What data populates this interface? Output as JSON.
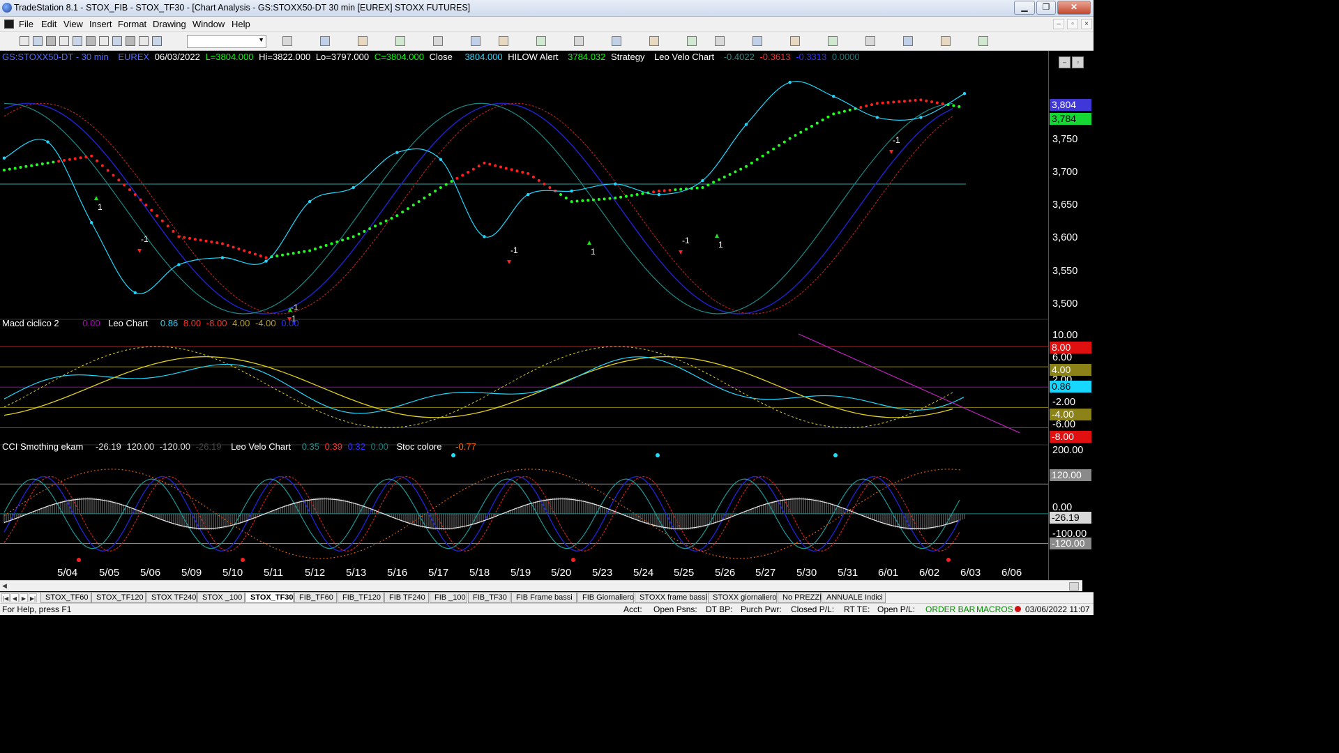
{
  "window": {
    "title": "TradeStation 8.1 - STOX_FIB - STOX_TF30 - [Chart Analysis - GS:STOXX50-DT  30 min  [EUREX] STOXX FUTURES]",
    "minimize": "▁",
    "restore": "❐",
    "close": "✕"
  },
  "menu": [
    "File",
    "Edit",
    "View",
    "Insert",
    "Format",
    "Drawing",
    "Window",
    "Help"
  ],
  "price_header": {
    "symbol": "GS:STOXX50-DT - 30 min",
    "exchange": "EUREX",
    "date": "06/03/2022",
    "last": "L=3804.000",
    "high": "Hi=3822.000",
    "low": "Lo=3797.000",
    "close_eq": "C=3804.000",
    "close_label": "Close",
    "close_val": "3804.000",
    "hilow_label": "HILOW Alert",
    "hilow_val": "3784.032",
    "strategy_label": "Strategy",
    "leo_label": "Leo Velo Chart",
    "leo_v1": "-0.4022",
    "leo_v2": "-0.3613",
    "leo_v3": "-0.3313",
    "leo_v4": "0.0000"
  },
  "macd_header": {
    "name": "Macd ciclico 2",
    "v0": "0.00",
    "leo_label": "Leo Chart",
    "v1": "0.86",
    "v2": "8.00",
    "v3": "-8.00",
    "v4": "4.00",
    "v5": "-4.00",
    "v6": "0.00"
  },
  "cci_header": {
    "name": "CCI Smothing ekam",
    "v1": "-26.19",
    "v2": "120.00",
    "v3": "-120.00",
    "v4": "-26.19",
    "leo_label": "Leo Velo Chart",
    "l1": "0.35",
    "l2": "0.39",
    "l3": "0.32",
    "l4": "0.00",
    "stoc_label": "Stoc colore",
    "stoc_val": "-0.77"
  },
  "price_axis": [
    "3,750",
    "3,700",
    "3,650",
    "3,600",
    "3,550",
    "3,500"
  ],
  "price_tags": {
    "last": "3,804",
    "hilow": "3,784"
  },
  "macd_axis": [
    "10.00",
    "6.00",
    "2.00",
    "-2.00",
    "-6.00"
  ],
  "macd_tags": {
    "t8": "8.00",
    "t4": "4.00",
    "cur": "0.86",
    "tm4": "-4.00",
    "tm8": "-8.00"
  },
  "cci_axis": [
    "200.00",
    "0.00",
    "-100.00"
  ],
  "cci_tags": {
    "t120": "120.00",
    "cur": "-26.19",
    "tm120": "-120.00"
  },
  "signal_labels": [
    "1",
    "-1",
    "-1",
    "1",
    "-1",
    "-1",
    "1",
    "1",
    "-1"
  ],
  "dates": [
    "5/04",
    "5/05",
    "5/06",
    "5/09",
    "5/10",
    "5/11",
    "5/12",
    "5/13",
    "5/16",
    "5/17",
    "5/18",
    "5/19",
    "5/20",
    "5/23",
    "5/24",
    "5/25",
    "5/26",
    "5/27",
    "5/30",
    "5/31",
    "6/01",
    "6/02",
    "6/03",
    "6/06"
  ],
  "tabs": [
    "STOX_TF60",
    "STOX_TF120",
    "STOX TF240",
    "STOX _100",
    "STOX_TF30",
    "FIB_TF60",
    "FIB_TF120",
    "FIB TF240",
    "FIB _100",
    "FIB_TF30",
    "FIB Frame bassi",
    "FIB Giornaliero",
    "STOXX frame bassi",
    "STOXX giornaliero",
    "No PREZZI",
    "ANNUALE Indici"
  ],
  "active_tab": "STOX_TF30",
  "status": {
    "help": "For Help, press F1",
    "acct": "Acct:",
    "open_psns": "Open Psns:",
    "dt_bp": "DT BP:",
    "purch": "Purch Pwr:",
    "closed_pl": "Closed P/L:",
    "rt_te": "RT TE:",
    "open_pl": "Open P/L:",
    "order_bar": "ORDER BAR",
    "macros": "MACROS",
    "datetime": "03/06/2022 11:07"
  },
  "chart_data": {
    "type": "line",
    "title": "GS:STOXX50-DT - 30 min",
    "x": [
      "5/04",
      "5/05",
      "5/06",
      "5/09",
      "5/10",
      "5/11",
      "5/12",
      "5/13",
      "5/16",
      "5/17",
      "5/18",
      "5/19",
      "5/20",
      "5/23",
      "5/24",
      "5/25",
      "5/26",
      "5/27",
      "5/30",
      "5/31",
      "6/01",
      "6/02",
      "6/03"
    ],
    "ylim": [
      3490,
      3840
    ],
    "series": [
      {
        "name": "Close",
        "values": [
          3712,
          3735,
          3620,
          3520,
          3560,
          3570,
          3565,
          3650,
          3670,
          3720,
          3710,
          3600,
          3660,
          3665,
          3675,
          3660,
          3680,
          3760,
          3820,
          3800,
          3770,
          3770,
          3804
        ]
      },
      {
        "name": "HILOW Alert",
        "values": [
          3695,
          3705,
          3715,
          3660,
          3600,
          3590,
          3570,
          3580,
          3600,
          3630,
          3670,
          3705,
          3690,
          3650,
          3655,
          3665,
          3670,
          3700,
          3740,
          3775,
          3790,
          3795,
          3784
        ]
      }
    ],
    "macd": {
      "ylim": [
        -10,
        12
      ],
      "levels": [
        8,
        4,
        0,
        -4,
        -8
      ],
      "current": 0.86
    },
    "cci": {
      "ylim": [
        -200,
        250
      ],
      "levels": [
        120,
        0,
        -120
      ],
      "current": -26.19
    }
  }
}
